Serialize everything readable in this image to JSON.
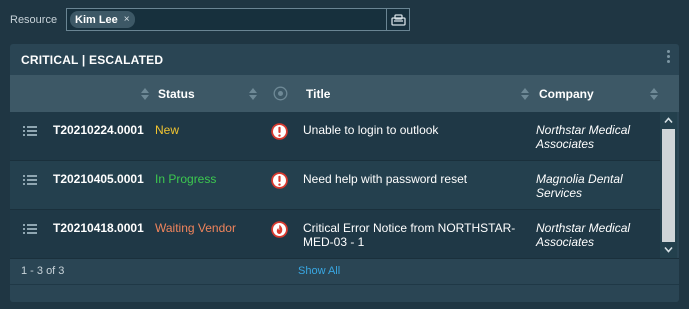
{
  "filter": {
    "label": "Resource",
    "chip": "Kim Lee",
    "chip_remove": "×"
  },
  "widget": {
    "title": "CRITICAL | ESCALATED",
    "columns": {
      "status": "Status",
      "title": "Title",
      "company": "Company"
    },
    "rows": [
      {
        "ticket": "T20210224.0001",
        "status": "New",
        "status_color": "#f2c530",
        "priority_icon": "alert-icon",
        "title": "Unable to login to outlook",
        "company": "Northstar Medical Associates"
      },
      {
        "ticket": "T20210405.0001",
        "status": "In Progress",
        "status_color": "#3cc84f",
        "priority_icon": "alert-icon",
        "title": "Need help with password reset",
        "company": "Magnolia Dental Services"
      },
      {
        "ticket": "T20210418.0001",
        "status": "Waiting Vendor",
        "status_color": "#f0845c",
        "priority_icon": "fire-icon",
        "title": "Critical Error Notice from NORTHSTAR-MED-03 - 1",
        "company": "Northstar Medical Associates"
      }
    ],
    "pagination": "1 - 3 of 3",
    "show_all": "Show All"
  },
  "colors": {
    "background": "#1f3643",
    "panel": "#2a4554",
    "header": "#3d5866",
    "link": "#39a7e2",
    "priority_red": "#d83a2f"
  }
}
